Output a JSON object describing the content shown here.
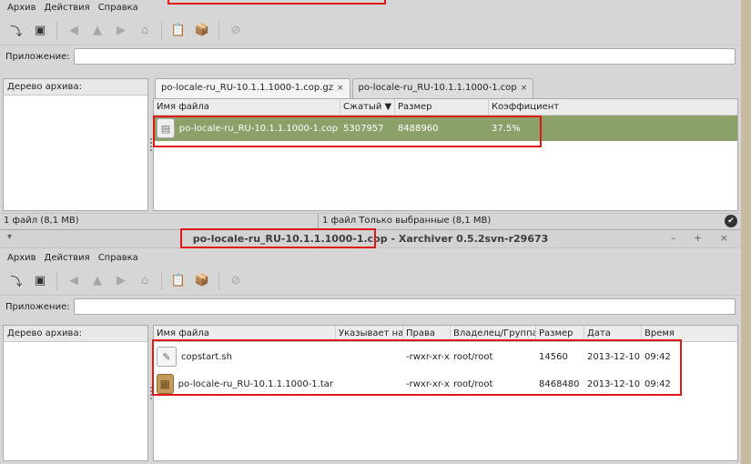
{
  "window1": {
    "menu": [
      "Архив",
      "Действия",
      "Справка"
    ],
    "app_label": "Приложение:",
    "tree_header": "Дерево архива:",
    "tabs": [
      {
        "label": "po-locale-ru_RU-10.1.1.1000-1.cop.gz",
        "close": "×"
      },
      {
        "label": "po-locale-ru_RU-10.1.1.1000-1.cop",
        "close": "×"
      }
    ],
    "columns": [
      "Имя файла",
      "Сжатый ▼",
      "Размер",
      "Коэффициент"
    ],
    "rows": [
      {
        "name": "po-locale-ru_RU-10.1.1.1000-1.cop",
        "compressed": "5307957",
        "size": "8488960",
        "ratio": "37.5%"
      }
    ],
    "status_left": "1 файл  (8,1 MB)",
    "status_right": "1 файл Только выбранные (8,1 MB)"
  },
  "window2": {
    "title_file": "po-locale-ru_RU-10.1.1.1000-1.cop",
    "title_rest": " - Xarchiver 0.5.2svn-r29673",
    "title_left_icon": "▾",
    "title_controls": "– + ×",
    "menu": [
      "Архив",
      "Действия",
      "Справка"
    ],
    "app_label": "Приложение:",
    "tree_header": "Дерево архива:",
    "columns": [
      "Имя файла",
      "Указывает на",
      "Права",
      "Владелец/Группа",
      "Размер",
      "Дата",
      "Время"
    ],
    "rows": [
      {
        "name": "copstart.sh",
        "link": "",
        "perms": "-rwxr-xr-x",
        "owner": "root/root",
        "size": "14560",
        "date": "2013-12-10",
        "time": "09:42",
        "icon": "script-icon"
      },
      {
        "name": "po-locale-ru_RU-10.1.1.1000-1.tar",
        "link": "",
        "perms": "-rwxr-xr-x",
        "owner": "root/root",
        "size": "8468480",
        "date": "2013-12-10",
        "time": "09:42",
        "icon": "archive-box-icon"
      }
    ]
  },
  "colors": {
    "highlight": "#e01818",
    "selected_row": "#8ca06a"
  }
}
